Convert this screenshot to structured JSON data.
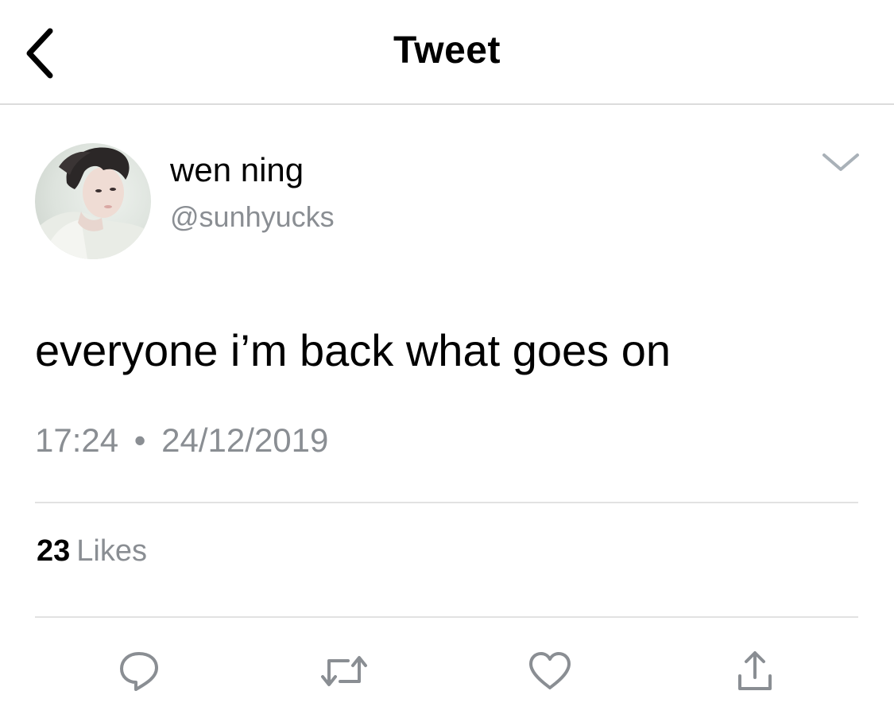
{
  "header": {
    "title": "Tweet"
  },
  "author": {
    "display_name": "wen ning",
    "handle": "@sunhyucks"
  },
  "tweet": {
    "text": "everyone i’m back what goes on",
    "time": "17:24",
    "separator": "•",
    "date": "24/12/2019"
  },
  "stats": {
    "likes_count": "23",
    "likes_label": "Likes"
  },
  "actions": [
    "reply-icon",
    "retweet-icon",
    "like-icon",
    "share-icon"
  ],
  "colors": {
    "icon_gray": "#8a8e93",
    "divider": "#e2e2e2",
    "text": "#000000"
  }
}
